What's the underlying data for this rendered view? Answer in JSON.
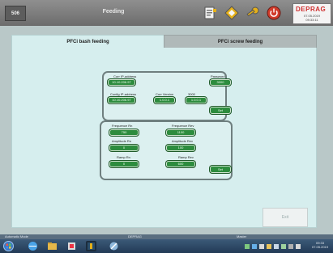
{
  "header": {
    "screen_id": "506",
    "title": "Feeding",
    "brand": "DEPRAG",
    "date": "07.05.2019",
    "time": "09:33:11"
  },
  "tabs": [
    {
      "label": "PFCi bash feeding",
      "active": true
    },
    {
      "label": "PFCi screw feeding",
      "active": false
    }
  ],
  "connection": {
    "ip_label": "Curr IP-address",
    "ip_value": "10.10.206.97",
    "config_label": "Config IP-address",
    "config_value": "10.10.206.97",
    "version_label": "Curr Version",
    "version_value": "1.0.0.1",
    "pass_label": "Password",
    "pass_value": "3000",
    "s6_label": "3000",
    "s6_value": "1.0.0.1",
    "set_label": "Set"
  },
  "params": {
    "f1_label": "Frequence Rn",
    "f1_value": "750",
    "f2_label": "Frequence Rev",
    "f2_value": "1100",
    "a1_label": "Amplitude Rn",
    "a1_value": "0",
    "a2_label": "Amplitude Rev",
    "a2_value": "100",
    "r1_label": "Ramp Rn",
    "r1_value": "0",
    "r2_label": "Ramp Rev",
    "r2_value": "600",
    "set_label": "Set"
  },
  "exit_label": "Exit",
  "status": {
    "mode": "Automatic Mode",
    "user": "DEPRAG",
    "level": "Master"
  },
  "tray": {
    "time": "09:33",
    "date": "07.05.2019"
  },
  "colors": {
    "field_green": "#2d8c3e",
    "panel": "#d6eeee",
    "titlebar": "#7b7b7b",
    "brand_red": "#cf2f2f"
  }
}
